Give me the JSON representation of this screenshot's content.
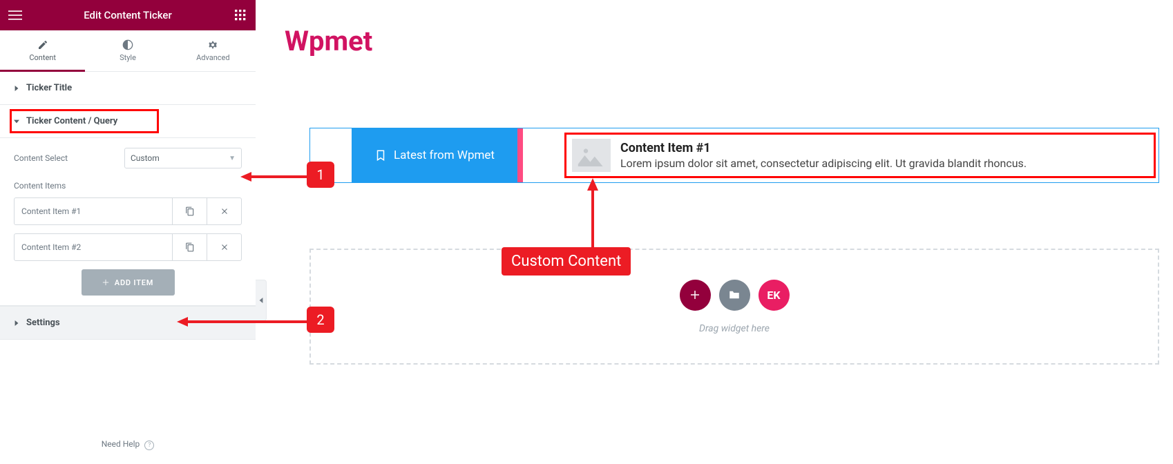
{
  "header": {
    "title": "Edit Content Ticker"
  },
  "tabs": {
    "content": "Content",
    "style": "Style",
    "advanced": "Advanced"
  },
  "sections": {
    "ticker_title": "Ticker Title",
    "ticker_content": "Ticker Content / Query",
    "settings": "Settings"
  },
  "controls": {
    "content_select_label": "Content Select",
    "content_select_value": "Custom",
    "content_items_label": "Content Items",
    "items": [
      {
        "label": "Content Item #1"
      },
      {
        "label": "Content Item #2"
      }
    ],
    "add_item": "ADD ITEM"
  },
  "footer": {
    "need_help": "Need Help"
  },
  "preview": {
    "brand": "Wpmet",
    "ticker_label": "Latest from Wpmet",
    "content_title": "Content Item #1",
    "content_desc": "Lorem ipsum dolor sit amet, consectetur adipiscing elit. Ut gravida blandit rhoncus.",
    "drag_text": "Drag widget here",
    "ek_label": "EK"
  },
  "callouts": {
    "one": "1",
    "two": "2",
    "custom_content": "Custom Content"
  }
}
